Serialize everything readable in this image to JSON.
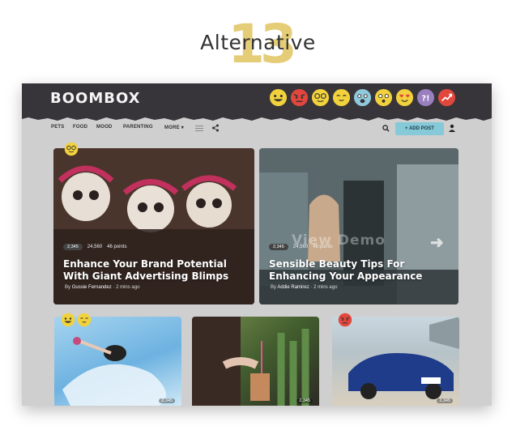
{
  "heading": {
    "number": "13",
    "title": "Alternative"
  },
  "app": {
    "logo_text": "BOOMBOX",
    "reaction_icons": [
      "lol-icon",
      "angry-icon",
      "geeky-icon",
      "cute-icon",
      "scary-icon",
      "omg-icon",
      "love-icon",
      "wtf-icon",
      "trending-icon"
    ]
  },
  "nav": {
    "items": [
      "PETS",
      "FOOD",
      "MOOD",
      "PARENTING",
      "MORE"
    ],
    "more_caret": "▾",
    "add_post_label": "+ ADD POST"
  },
  "featured": [
    {
      "share_count": "2,345",
      "views": "24,560",
      "points": "46 points",
      "headline_line1": "Enhance Your Brand Potential",
      "headline_line2": "With Giant Advertising Blimps",
      "by": "By",
      "author": "Gussie Fernandez",
      "time": "2 mins ago"
    },
    {
      "share_count": "2,345",
      "views": "24,560",
      "points": "46 points",
      "headline_line1": "Sensible Beauty Tips For",
      "headline_line2": "Enhancing Your Appearance",
      "by": "By",
      "author": "Addie Ramirez",
      "time": "2 mins ago",
      "watermark": "View Demo"
    }
  ],
  "small_cards": [
    {
      "share_count": "2,345"
    },
    {
      "share_count": "2,345"
    },
    {
      "share_count": "2,345"
    }
  ],
  "colors": {
    "topbar": "#38353a",
    "accent": "#86c9d8",
    "number": "#e3c768"
  }
}
